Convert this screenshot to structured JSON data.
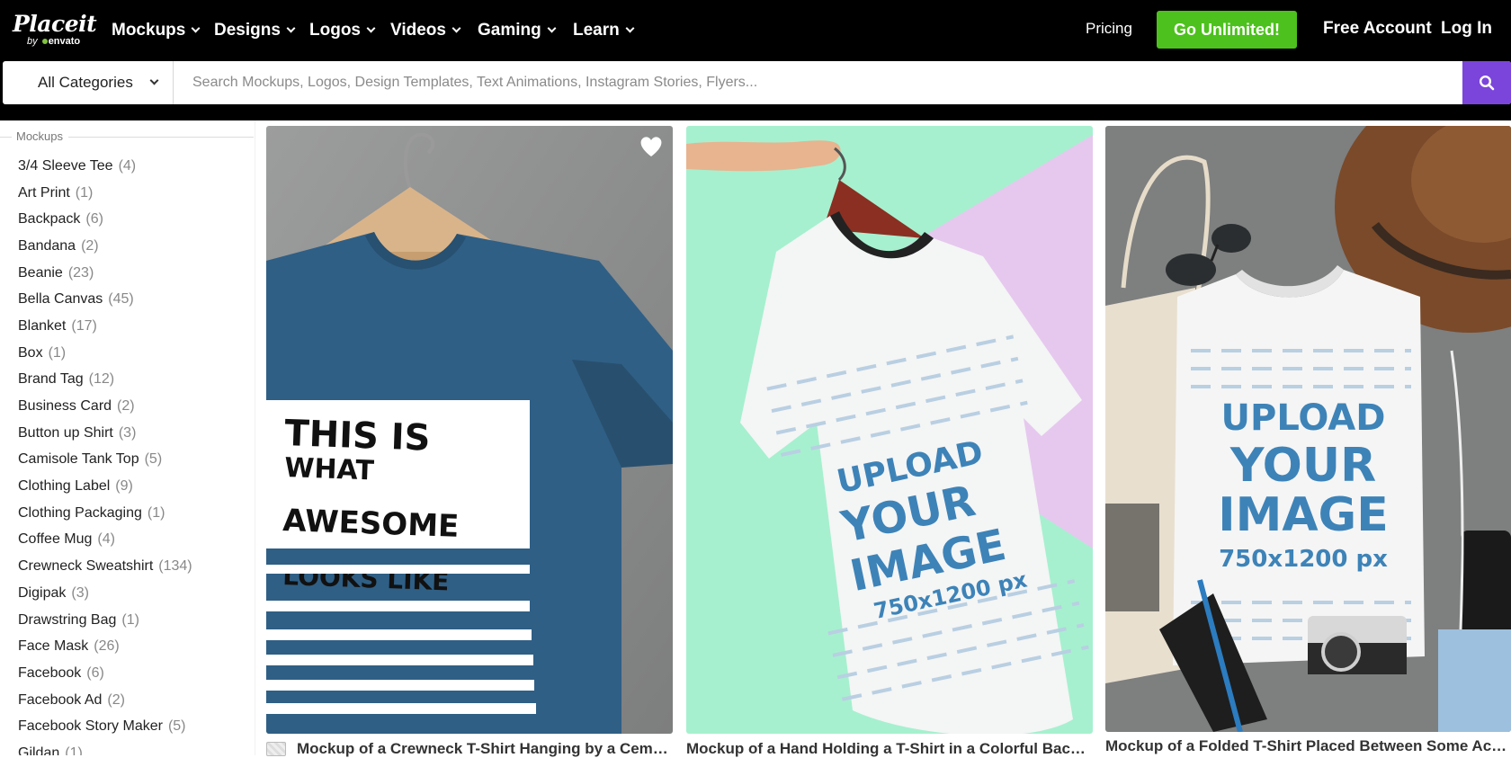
{
  "logo": {
    "name": "Placeit",
    "by": "by",
    "brand": "envato"
  },
  "nav": {
    "items": [
      {
        "label": "Mockups"
      },
      {
        "label": "Designs"
      },
      {
        "label": "Logos"
      },
      {
        "label": "Videos"
      },
      {
        "label": "Gaming"
      },
      {
        "label": "Learn"
      }
    ],
    "pricing": "Pricing",
    "cta": "Go Unlimited!",
    "free_account": "Free Account",
    "login": "Log In"
  },
  "search": {
    "category": "All Categories",
    "placeholder": "Search Mockups, Logos, Design Templates, Text Animations, Instagram Stories, Flyers...",
    "value": "",
    "button_icon": "search-icon"
  },
  "sidebar": {
    "section_title": "Mockups",
    "items": [
      {
        "label": "3/4 Sleeve Tee",
        "count": "(4)"
      },
      {
        "label": "Art Print",
        "count": "(1)"
      },
      {
        "label": "Backpack",
        "count": "(6)"
      },
      {
        "label": "Bandana",
        "count": "(2)"
      },
      {
        "label": "Beanie",
        "count": "(23)"
      },
      {
        "label": "Bella Canvas",
        "count": "(45)"
      },
      {
        "label": "Blanket",
        "count": "(17)"
      },
      {
        "label": "Box",
        "count": "(1)"
      },
      {
        "label": "Brand Tag",
        "count": "(12)"
      },
      {
        "label": "Business Card",
        "count": "(2)"
      },
      {
        "label": "Button up Shirt",
        "count": "(3)"
      },
      {
        "label": "Camisole Tank Top",
        "count": "(5)"
      },
      {
        "label": "Clothing Label",
        "count": "(9)"
      },
      {
        "label": "Clothing Packaging",
        "count": "(1)"
      },
      {
        "label": "Coffee Mug",
        "count": "(4)"
      },
      {
        "label": "Crewneck Sweatshirt",
        "count": "(134)"
      },
      {
        "label": "Digipak",
        "count": "(3)"
      },
      {
        "label": "Drawstring Bag",
        "count": "(1)"
      },
      {
        "label": "Face Mask",
        "count": "(26)"
      },
      {
        "label": "Facebook",
        "count": "(6)"
      },
      {
        "label": "Facebook Ad",
        "count": "(2)"
      },
      {
        "label": "Facebook Story Maker",
        "count": "(5)"
      },
      {
        "label": "Gildan",
        "count": "(1)"
      }
    ]
  },
  "cards": [
    {
      "caption": "Mockup of a Crewneck T-Shirt Hanging by a Cement Wall",
      "shirt_lines": [
        "THIS IS",
        "WHAT",
        "AWESOME",
        "LOOKS LIKE"
      ],
      "colors": {
        "background": "#8a8b8b",
        "shirt": "#2f5f85"
      }
    },
    {
      "caption": "Mockup of a Hand Holding a T-Shirt in a Colorful Background",
      "shirt_lines": [
        "UPLOAD",
        "YOUR",
        "IMAGE",
        "750x1200 px"
      ],
      "colors": {
        "background": "#a6f0cf",
        "accent": "#e6c8ee"
      }
    },
    {
      "caption": "Mockup of a Folded T-Shirt Placed Between Some Accessories",
      "shirt_lines": [
        "UPLOAD",
        "YOUR",
        "IMAGE",
        "750x1200 px"
      ],
      "colors": {
        "background": "#7e7f7f",
        "hat": "#7a4a2a"
      }
    }
  ],
  "colors": {
    "topbar": "#000000",
    "cta": "#4dc11d",
    "search_button": "#7b45db",
    "upload_text": "#3d83b8"
  }
}
